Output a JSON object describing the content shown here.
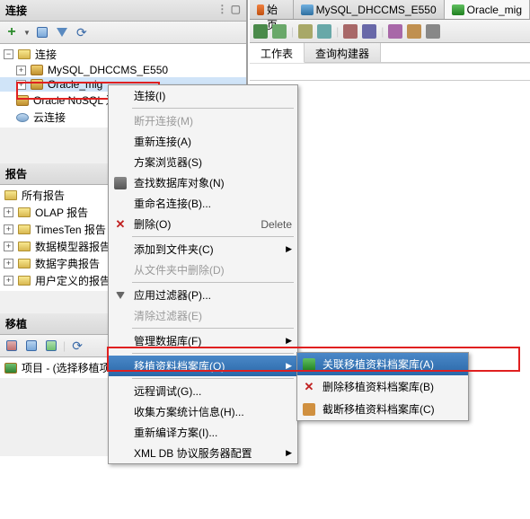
{
  "left": {
    "header": "连接",
    "items": [
      {
        "label": "连接"
      },
      {
        "label": "MySQL_DHCCMS_E550"
      },
      {
        "label": "Oracle_mig"
      },
      {
        "label": "Oracle NoSQL 连接"
      },
      {
        "label": "云连接"
      }
    ],
    "reports_header": "报告",
    "reports": [
      {
        "label": "所有报告"
      },
      {
        "label": "OLAP 报告"
      },
      {
        "label": "TimesTen 报告"
      },
      {
        "label": "数据模型器报告"
      },
      {
        "label": "数据字典报告"
      },
      {
        "label": "用户定义的报告"
      }
    ],
    "migrate_header": "移植",
    "migrate_label": "项目 - (选择移植项目)"
  },
  "right": {
    "tabs": [
      {
        "label": "起始页"
      },
      {
        "label": "MySQL_DHCCMS_E550"
      },
      {
        "label": "Oracle_mig"
      }
    ],
    "subtabs": [
      {
        "label": "工作表"
      },
      {
        "label": "查询构建器"
      }
    ]
  },
  "menu": {
    "connect": "连接(I)",
    "disconnect": "断开连接(M)",
    "reconnect": "重新连接(A)",
    "schema_browser": "方案浏览器(S)",
    "find_obj": "查找数据库对象(N)",
    "rename": "重命名连接(B)...",
    "delete": "删除(O)",
    "delete_sc": "Delete",
    "add_folder": "添加到文件夹(C)",
    "del_from_folder": "从文件夹中删除(D)",
    "apply_filter": "应用过滤器(P)...",
    "clear_filter": "清除过滤器(E)",
    "manage_db": "管理数据库(F)",
    "migrate_repo": "移植资料档案库(O)",
    "remote_debug": "远程调试(G)...",
    "gather_stats": "收集方案统计信息(H)...",
    "recompile": "重新编译方案(I)...",
    "xmldb": "XML DB 协议服务器配置"
  },
  "submenu": {
    "associate": "关联移植资料档案库(A)",
    "delete_repo": "删除移植资料档案库(B)",
    "truncate": "截断移植资料档案库(C)"
  }
}
